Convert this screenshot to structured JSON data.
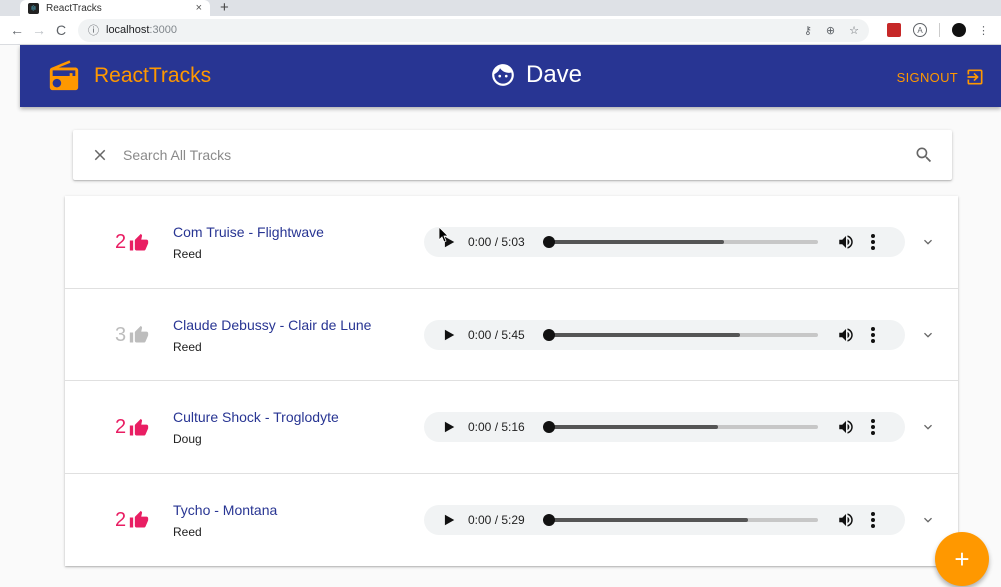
{
  "browser": {
    "tab_title": "ReactTracks",
    "tab_close": "×",
    "new_tab": "+",
    "url_host": "localhost",
    "url_port": ":3000"
  },
  "app": {
    "brand_name": "ReactTracks",
    "username": "Dave",
    "signout_label": "SIGNOUT",
    "accent_color": "#ff9800",
    "primary_color": "#283593",
    "like_active_color": "#e91e63"
  },
  "search": {
    "placeholder": "Search All Tracks",
    "value": ""
  },
  "tracks": [
    {
      "likes": "2",
      "liked": true,
      "title": "Com Truise - Flightwave",
      "user": "Reed",
      "time": "0:00 / 5:03",
      "progress": 0.65
    },
    {
      "likes": "3",
      "liked": false,
      "title": "Claude Debussy - Clair de Lune",
      "user": "Reed",
      "time": "0:00 / 5:45",
      "progress": 0.71
    },
    {
      "likes": "2",
      "liked": true,
      "title": "Culture Shock - Troglodyte",
      "user": "Doug",
      "time": "0:00 / 5:16",
      "progress": 0.63
    },
    {
      "likes": "2",
      "liked": true,
      "title": "Tycho - Montana",
      "user": "Reed",
      "time": "0:00 / 5:29",
      "progress": 0.74
    }
  ],
  "fab_label": "+"
}
